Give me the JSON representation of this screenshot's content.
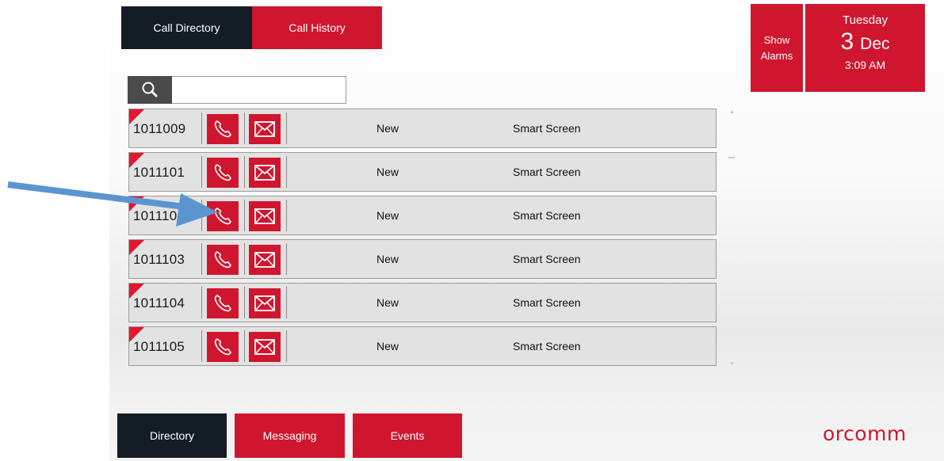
{
  "top_tabs": [
    {
      "label": "Call Directory",
      "active": true
    },
    {
      "label": "Call History",
      "active": false
    }
  ],
  "alarms_button": {
    "line1": "Show",
    "line2": "Alarms"
  },
  "datetime": {
    "weekday": "Tuesday",
    "day": "3",
    "month": "Dec",
    "time": "3:09 AM"
  },
  "search": {
    "value": "",
    "placeholder": "",
    "icon": "search-icon"
  },
  "directory": {
    "rows": [
      {
        "number": "1011009",
        "status": "New",
        "type": "Smart Screen"
      },
      {
        "number": "1011101",
        "status": "New",
        "type": "Smart Screen"
      },
      {
        "number": "1011102",
        "status": "New",
        "type": "Smart Screen"
      },
      {
        "number": "1011103",
        "status": "New",
        "type": "Smart Screen"
      },
      {
        "number": "1011104",
        "status": "New",
        "type": "Smart Screen"
      },
      {
        "number": "1011105",
        "status": "New",
        "type": "Smart Screen"
      }
    ],
    "row_icons": [
      "phone-icon",
      "envelope-icon"
    ]
  },
  "bottom_nav": [
    {
      "label": "Directory",
      "active": true
    },
    {
      "label": "Messaging",
      "active": false
    },
    {
      "label": "Events",
      "active": false
    }
  ],
  "brand": {
    "logo_text": "orcomm",
    "accent": "#d0162e",
    "dark": "#141c25",
    "annotation_arrow": "#5b95cf"
  }
}
